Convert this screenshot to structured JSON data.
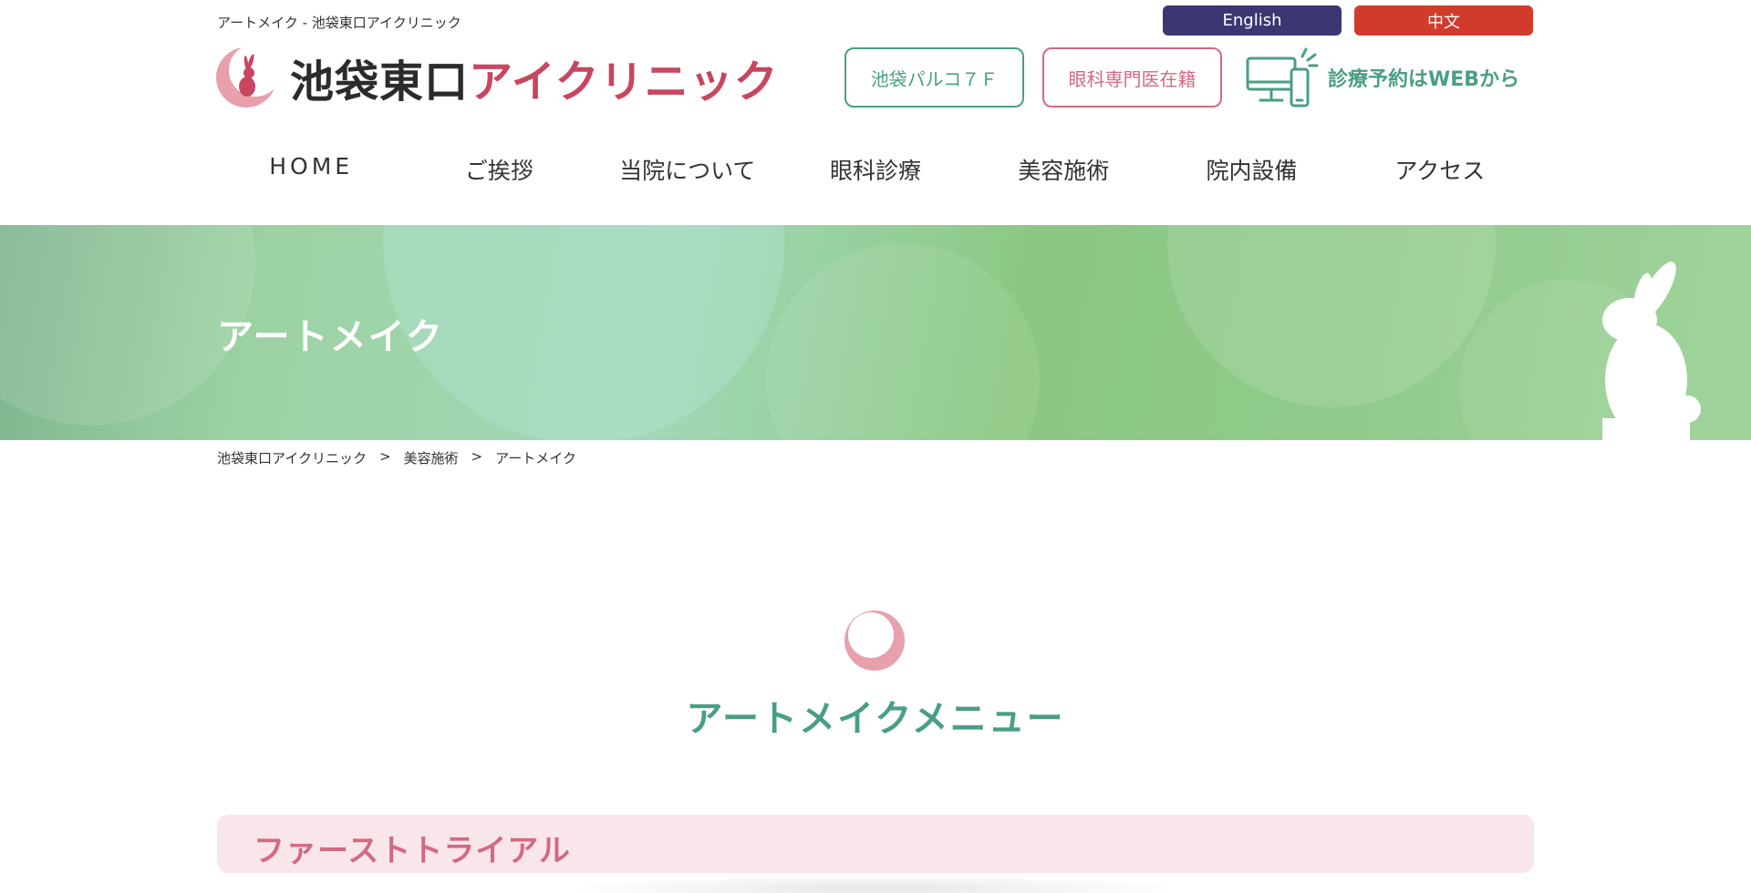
{
  "header": {
    "page_subtitle": "アートメイク - 池袋東口アイクリニック",
    "logo_dark": "池袋東口",
    "logo_pink": "アイクリニック",
    "lang_english": "English",
    "lang_chinese": "中文",
    "parco_label": "池袋パルコ７Ｆ",
    "doctor_label": "眼科専門医在籍",
    "web_reserve_label": "診療予約はWEBから"
  },
  "nav": {
    "items": [
      "HOME",
      "ご挨拶",
      "当院について",
      "眼科診療",
      "美容施術",
      "院内設備",
      "アクセス"
    ]
  },
  "hero": {
    "title": "アートメイク"
  },
  "breadcrumb": {
    "items": [
      "池袋東口アイクリニック",
      "美容施術",
      "アートメイク"
    ],
    "separator": ">"
  },
  "section": {
    "title": "アートメイクメニュー"
  },
  "menu": {
    "first_card_title": "ファーストトライアル"
  },
  "colors": {
    "green": "#4a9e86",
    "pink": "#d16a82",
    "navy": "#3b3772",
    "red": "#d13b2c"
  }
}
